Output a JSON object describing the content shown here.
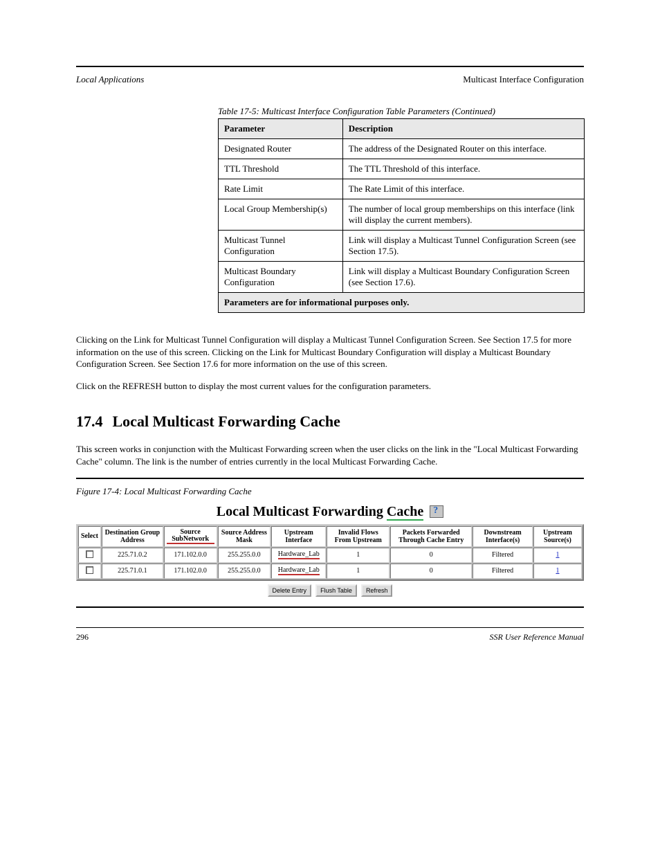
{
  "header": {
    "left": "Local Applications",
    "right": "Multicast Interface Configuration"
  },
  "params": {
    "caption": "Table 17-5: Multicast Interface Configuration Table Parameters (Continued)",
    "col_param": "Parameter",
    "col_desc": "Description",
    "rows": [
      {
        "param": "Designated Router",
        "desc": "The address of the Designated Router on this interface."
      },
      {
        "param": "TTL Threshold",
        "desc": "The TTL Threshold of this interface."
      },
      {
        "param": "Rate Limit",
        "desc": "The Rate Limit of this interface."
      },
      {
        "param": "Local Group Membership(s)",
        "desc": "The number of local group memberships on this interface (link will display the current members)."
      },
      {
        "param": "Multicast Tunnel Configuration",
        "desc": "Link will display a Multicast Tunnel Configuration Screen (see Section 17.5)."
      },
      {
        "param": "Multicast Boundary Configuration",
        "desc": "Link will display a Multicast Boundary Configuration Screen (see Section 17.6)."
      }
    ],
    "footer": "Parameters are for informational purposes only."
  },
  "body": {
    "p1": "Clicking on the Link for Multicast Tunnel Configuration will display a Multicast Tunnel Configuration Screen. See Section 17.5 for more information on the use of this screen. Clicking on the Link for Multicast Boundary Configuration will display a Multicast Boundary Configuration Screen. See Section 17.6 for more information on the use of this screen.",
    "p2": "Click on the REFRESH button to display the most current values for the configuration parameters."
  },
  "section": {
    "num": "17.4",
    "title": "Local Multicast Forwarding Cache"
  },
  "section_p1": "This screen works in conjunction with the Multicast Forwarding screen when the user clicks on the link in the \"Local Multicast Forwarding Cache\" column. The link is the number of entries currently in the local Multicast Forwarding Cache.",
  "figure": {
    "caption": "Figure 17-4: Local Multicast Forwarding Cache",
    "title_a": "Local Multicast Forwarding ",
    "title_b": "Cache",
    "help_name": "help-icon"
  },
  "cache": {
    "headers": [
      "Select",
      "Destination Group Address",
      "Source SubNetwork",
      "Source Address Mask",
      "Upstream Interface",
      "Invalid Flows From Upstream",
      "Packets Forwarded Through Cache Entry",
      "Downstream Interface(s)",
      "Upstream Source(s)"
    ],
    "rows": [
      {
        "dest": "225.71.0.2",
        "src_sub": "171.102.0.0",
        "src_mask": "255.255.0.0",
        "upstream_if": "Hardware_Lab",
        "invalid": "1",
        "pkts": "0",
        "down": "Filtered",
        "up_src": "1"
      },
      {
        "dest": "225.71.0.1",
        "src_sub": "171.102.0.0",
        "src_mask": "255.255.0.0",
        "upstream_if": "Hardware_Lab",
        "invalid": "1",
        "pkts": "0",
        "down": "Filtered",
        "up_src": "1"
      }
    ],
    "buttons": {
      "delete": "Delete Entry",
      "flush": "Flush Table",
      "refresh": "Refresh"
    }
  },
  "footer": {
    "left": "296",
    "right": "SSR User Reference Manual"
  }
}
